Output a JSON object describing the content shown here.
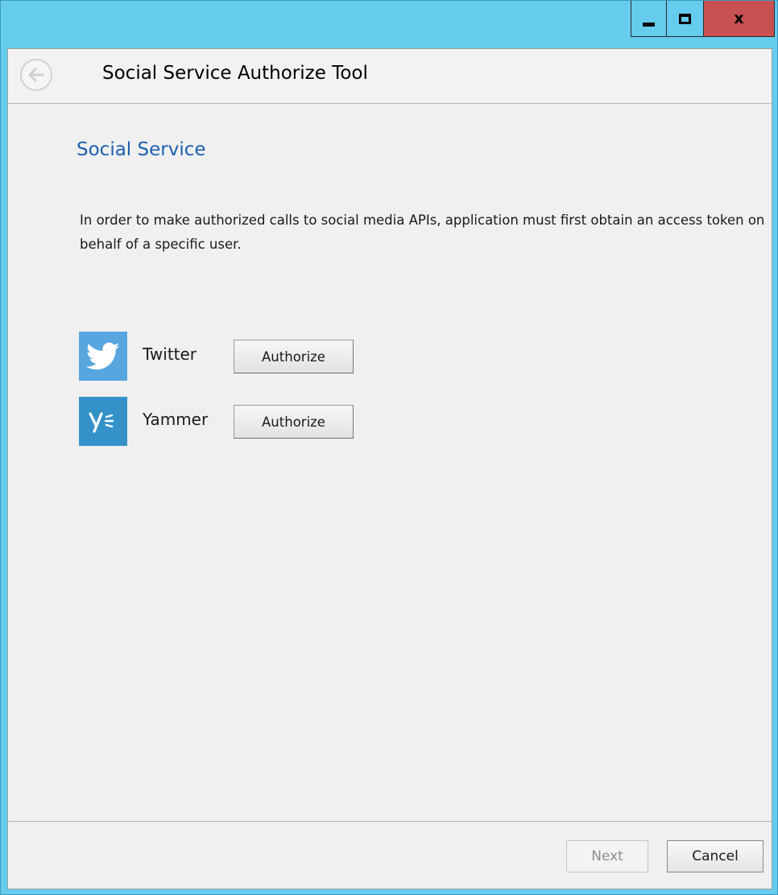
{
  "window": {
    "title": "",
    "caption_buttons": {
      "minimize_icon": "minimize-icon",
      "maximize_icon": "maximize-icon",
      "close_label": "x"
    },
    "accent_color": "#66ccee",
    "close_color": "#c75050"
  },
  "header": {
    "back_icon": "back-arrow-icon",
    "title": "Social Service Authorize Tool"
  },
  "main": {
    "section_title": "Social Service",
    "section_title_color": "#1c5fb0",
    "description": "In order to make authorized calls to social media APIs, application must first obtain an access token on behalf of a specific user.",
    "services": [
      {
        "name": "Twitter",
        "icon": "twitter-icon",
        "button_label": "Authorize",
        "brand_color": "#57a6df"
      },
      {
        "name": "Yammer",
        "icon": "yammer-icon",
        "button_label": "Authorize",
        "brand_color": "#3592c9"
      }
    ]
  },
  "footer": {
    "next_label": "Next",
    "next_enabled": false,
    "cancel_label": "Cancel"
  }
}
